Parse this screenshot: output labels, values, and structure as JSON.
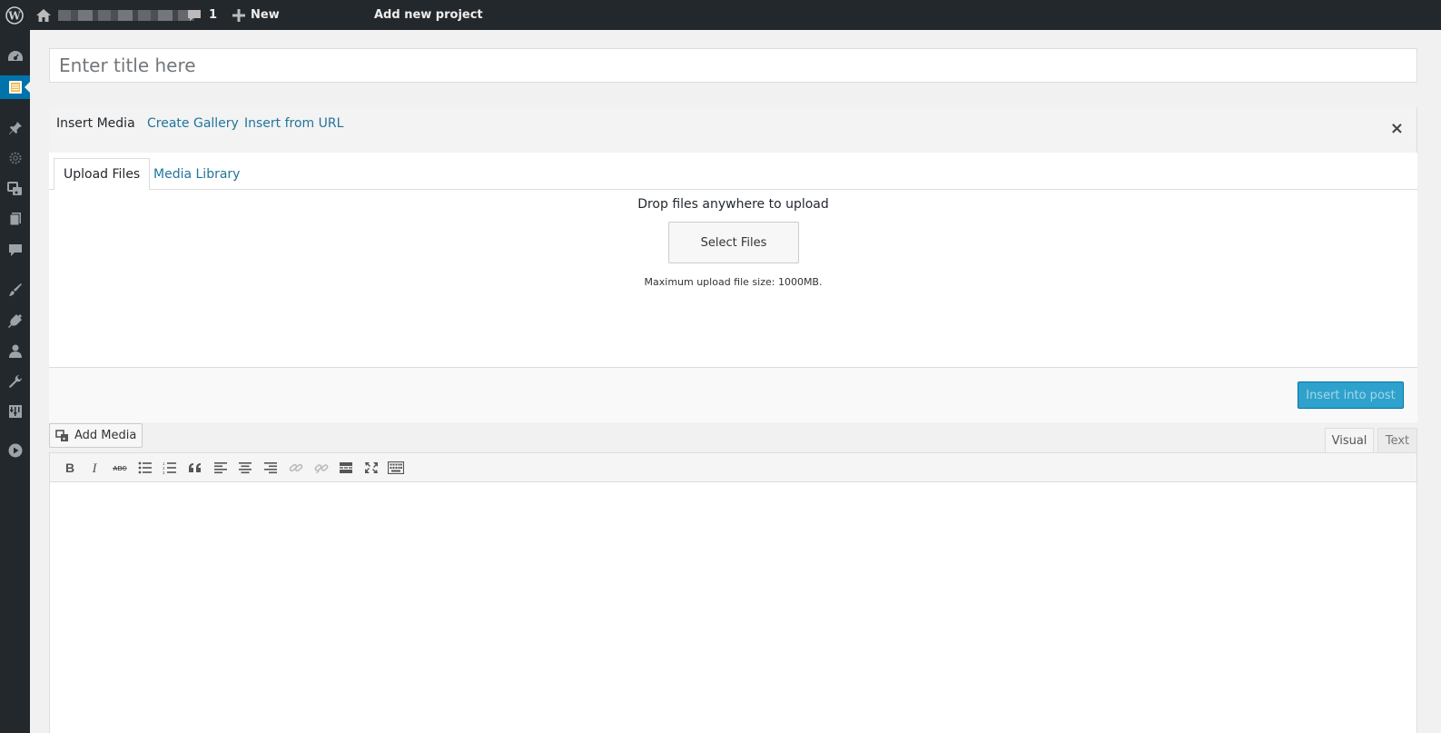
{
  "adminbar": {
    "comments_count": "1",
    "new_label": "New",
    "page_label": "Add new project"
  },
  "adminmenu": {
    "items": [
      {
        "icon": "dashboard-icon"
      },
      {
        "icon": "projects-icon",
        "current": true
      },
      {
        "icon": "posts-pin-icon"
      },
      {
        "icon": "gear-icon"
      },
      {
        "icon": "media-icon"
      },
      {
        "icon": "pages-icon"
      },
      {
        "icon": "comments-icon"
      },
      {
        "icon": "appearance-brush-icon"
      },
      {
        "icon": "plugins-icon"
      },
      {
        "icon": "users-icon"
      },
      {
        "icon": "tools-wrench-icon"
      },
      {
        "icon": "settings-icon"
      },
      {
        "icon": "collapse-play-icon"
      }
    ]
  },
  "title": {
    "placeholder": "Enter title here"
  },
  "media_modal": {
    "router": [
      "Insert Media",
      "Create Gallery",
      "Insert from URL"
    ],
    "close_label": "×",
    "tabs": [
      "Upload Files",
      "Media Library"
    ],
    "drop_text": "Drop files anywhere to upload",
    "select_files": "Select Files",
    "max_size": "Maximum upload file size: 1000MB.",
    "insert_button": "Insert into post"
  },
  "editor": {
    "add_media": "Add Media",
    "visual_tab": "Visual",
    "text_tab": "Text",
    "toolbar": [
      "bold",
      "italic",
      "strikethrough",
      "bullet-list",
      "numbered-list",
      "blockquote",
      "align-left",
      "align-center",
      "align-right",
      "link",
      "unlink",
      "read-more",
      "fullscreen",
      "toolbar-toggle"
    ]
  }
}
